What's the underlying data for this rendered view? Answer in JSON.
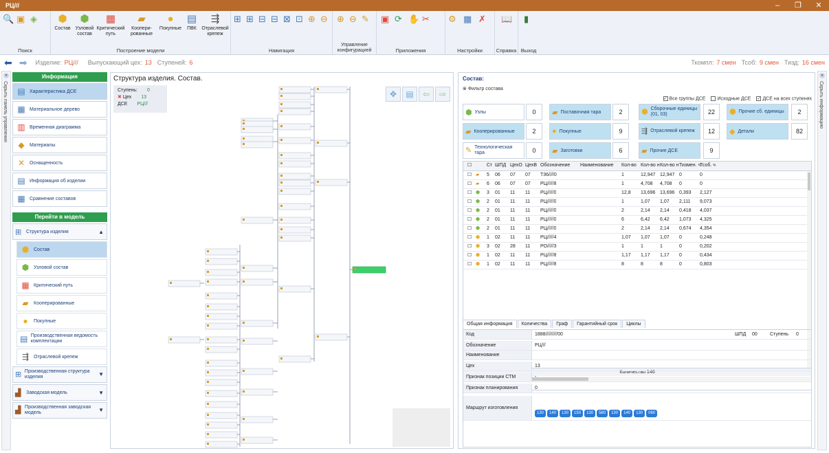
{
  "window": {
    "title": "PЦ///"
  },
  "ribbon": {
    "groups": [
      {
        "label": "Поиск"
      },
      {
        "label": "Построение модели"
      },
      {
        "label": "Навигация"
      },
      {
        "label": "Управление конфигурацией"
      },
      {
        "label": "Приложения"
      },
      {
        "label": "Настройки"
      },
      {
        "label": "Справка"
      },
      {
        "label": "Выход"
      }
    ],
    "buttons": [
      {
        "label": "Состав"
      },
      {
        "label": "Узловой состав"
      },
      {
        "label": "Критический путь"
      },
      {
        "label": "Коопери-рованные"
      },
      {
        "label": "Покупные"
      },
      {
        "label": "ПВК"
      },
      {
        "label": "Отраслевой крепеж"
      }
    ]
  },
  "infobar": {
    "product_label": "Изделие:",
    "product_value": "РЦ///",
    "workshop_label": "Выпускающий цех:",
    "workshop_value": "13",
    "levels_label": "Ступеней:",
    "levels_value": "6",
    "tcomp_label": "Ткомпл:",
    "tcomp_value": "7 смен",
    "tsob_label": "Тсоб:",
    "tsob_value": "9 смен",
    "tizd_label": "Тизд:",
    "tizd_value": "16 смен"
  },
  "left_strip": {
    "text": "Скрыть панель управления"
  },
  "right_strip": {
    "text": "Скрыть информацию"
  },
  "leftnav": {
    "info_header": "Информация",
    "info_items": [
      {
        "label": "Характеристика ДСЕ"
      },
      {
        "label": "Материальное дерево"
      },
      {
        "label": "Временная диаграмма"
      },
      {
        "label": "Материалы"
      },
      {
        "label": "Оснащенность"
      },
      {
        "label": "Информация об изделии"
      },
      {
        "label": "Сравнение составов"
      }
    ],
    "goto_header": "Перейти в модель",
    "structure_group": "Структура изделия",
    "sub_items": [
      {
        "label": "Состав"
      },
      {
        "label": "Узловой состав"
      },
      {
        "label": "Критический путь"
      },
      {
        "label": "Кооперированные"
      },
      {
        "label": "Покупные"
      },
      {
        "label": "Производственная ведомость комплектации"
      },
      {
        "label": "Отраслевой крепеж"
      }
    ],
    "groups": [
      {
        "label": "Производственная структура изделия"
      },
      {
        "label": "Заводская модель"
      },
      {
        "label": "Производственная заводская модель"
      }
    ]
  },
  "tree": {
    "title": "Структура изделия.  Состав.",
    "legend": {
      "levels_label": "Ступень",
      "levels_value": "0",
      "shop_label": "Цех",
      "shop_value": "13",
      "dse_label": "ДСЕ",
      "dse_value": "РЦ///"
    }
  },
  "right": {
    "title": "Состав:",
    "filter": "Фильтр состава",
    "checks": [
      {
        "label": "Все группы ДСЕ",
        "checked": true
      },
      {
        "label": "Исходные ДСЕ",
        "checked": false
      },
      {
        "label": "ДСЕ на всех ступенях",
        "checked": true
      }
    ],
    "tiles": [
      {
        "label": "Узлы",
        "value": "0"
      },
      {
        "label": "Поставочная тара",
        "value": "2"
      },
      {
        "label": "Сборочные единицы (01, 03)",
        "value": "22"
      },
      {
        "label": "Прочие сб. единицы",
        "value": "2"
      },
      {
        "label": "Кооперированные",
        "value": "2"
      },
      {
        "label": "Покупные",
        "value": "9"
      },
      {
        "label": "Отраслевой крепеж",
        "value": "12"
      },
      {
        "label": "Детали",
        "value": "82"
      },
      {
        "label": "Технологическая тара",
        "value": "0"
      },
      {
        "label": "Заготовки",
        "value": "6"
      },
      {
        "label": "Прочие ДСЕ",
        "value": "9"
      }
    ],
    "grid": {
      "headers": [
        "Ст",
        "ШПД",
        "ЦехО",
        "ЦехВ",
        "Обозначение",
        "Наименование",
        "Кол-во",
        "Кол-во н",
        "Кол-во н",
        "Тизмен. ч",
        "Тсоб. ч"
      ],
      "rows": [
        [
          "5",
          "06",
          "07",
          "07",
          "Т36////0",
          "",
          "1",
          "12,947",
          "12,947",
          "0",
          "0"
        ],
        [
          "6",
          "06",
          "07",
          "07",
          "РЦ/////8",
          "",
          "1",
          "4,708",
          "4,708",
          "0",
          "0"
        ],
        [
          "3",
          "01",
          "11",
          "11",
          "РЦ/////0",
          "",
          "12,8",
          "13,696",
          "13,696",
          "0,393",
          "2,127"
        ],
        [
          "2",
          "01",
          "11",
          "11",
          "РЦ/////0",
          "",
          "1",
          "1,07",
          "1,07",
          "2,111",
          "9,073"
        ],
        [
          "2",
          "01",
          "11",
          "11",
          "РЦ/////0",
          "",
          "2",
          "2,14",
          "2,14",
          "0,418",
          "4,037"
        ],
        [
          "2",
          "01",
          "11",
          "11",
          "РЦ/////0",
          "",
          "6",
          "6,42",
          "6,42",
          "1,073",
          "4,325"
        ],
        [
          "2",
          "01",
          "11",
          "11",
          "РЦ/////0",
          "",
          "2",
          "2,14",
          "2,14",
          "0,674",
          "4,354"
        ],
        [
          "1",
          "02",
          "11",
          "11",
          "РЦ/////4",
          "",
          "1,07",
          "1,07",
          "1,07",
          "0",
          "0,248"
        ],
        [
          "3",
          "02",
          "28",
          "11",
          "РО/////3",
          "",
          "1",
          "1",
          "1",
          "0",
          "0,202"
        ],
        [
          "1",
          "02",
          "11",
          "11",
          "РЦ/////8",
          "",
          "1,17",
          "1,17",
          "1,17",
          "0",
          "0,434"
        ],
        [
          "1",
          "02",
          "11",
          "11",
          "РЦ/////8",
          "",
          "8",
          "8",
          "8",
          "0",
          "0,803"
        ]
      ],
      "footer": "Количество 146"
    },
    "tabs": [
      {
        "label": "Общая информация"
      },
      {
        "label": "Количества"
      },
      {
        "label": "Граф"
      },
      {
        "label": "Гарантийный срок"
      },
      {
        "label": "Циклы"
      }
    ],
    "details": {
      "code_label": "Код",
      "code_value": "1888/////////00",
      "shpd_label": "ШПД",
      "shpd_value": "00",
      "level_label": "Ступень",
      "level_value": "0",
      "designation_label": "Обозначение",
      "designation_value": "РЦ///",
      "name_label": "Наименование",
      "name_value": "",
      "shop_label": "Цех",
      "shop_value": "13",
      "stm_label": "Признак позиции СТМ",
      "stm_value": "-",
      "plan_label": "Признак планирования",
      "plan_value": "0",
      "route_label": "Маршрут изготовления",
      "route": [
        "130",
        "140",
        "130",
        "150",
        "130",
        "580",
        "130",
        "140",
        "130",
        "060"
      ]
    }
  }
}
